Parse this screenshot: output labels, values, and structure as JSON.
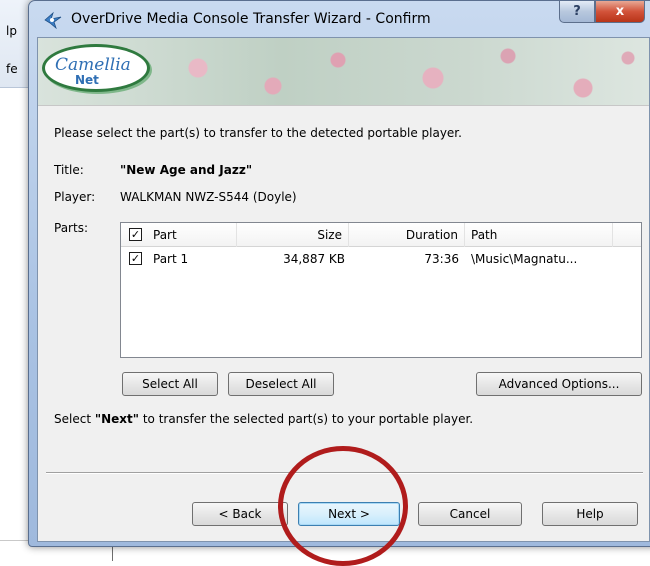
{
  "background_app": {
    "fragments": [
      "lp",
      "fe"
    ]
  },
  "window": {
    "title": "OverDrive Media Console Transfer Wizard - Confirm",
    "help_glyph": "?",
    "close_glyph": "x"
  },
  "banner": {
    "logo_text": "Camellia",
    "logo_sub": "Net"
  },
  "instruction": "Please select the part(s) to transfer to the detected portable player.",
  "fields": {
    "title_label": "Title:",
    "title_value": "\"New Age and Jazz\"",
    "player_label": "Player:",
    "player_value": "WALKMAN NWZ-S544 (Doyle)",
    "parts_label": "Parts:"
  },
  "parts_table": {
    "header_checked": true,
    "columns": [
      "Part",
      "Size",
      "Duration",
      "Path"
    ],
    "rows": [
      {
        "checked": true,
        "part": "Part 1",
        "size": "34,887 KB",
        "duration": "73:36",
        "path": "\\Music\\Magnatu..."
      }
    ]
  },
  "buttons": {
    "select_all": "Select All",
    "deselect_all": "Deselect All",
    "advanced_options": "Advanced Options...",
    "back": "< Back",
    "next": "Next >",
    "cancel": "Cancel",
    "help": "Help"
  },
  "next_hint": {
    "prefix": "Select ",
    "keyword": "\"Next\"",
    "suffix": " to transfer the selected part(s) to your portable player."
  },
  "colors": {
    "annotation_circle": "#b01c1c",
    "logo_green": "#2f7a3f",
    "logo_blue": "#2f6fb4"
  },
  "icons": {
    "title_icon": "overdrive-wizard-icon",
    "check": "check-mark-icon"
  }
}
